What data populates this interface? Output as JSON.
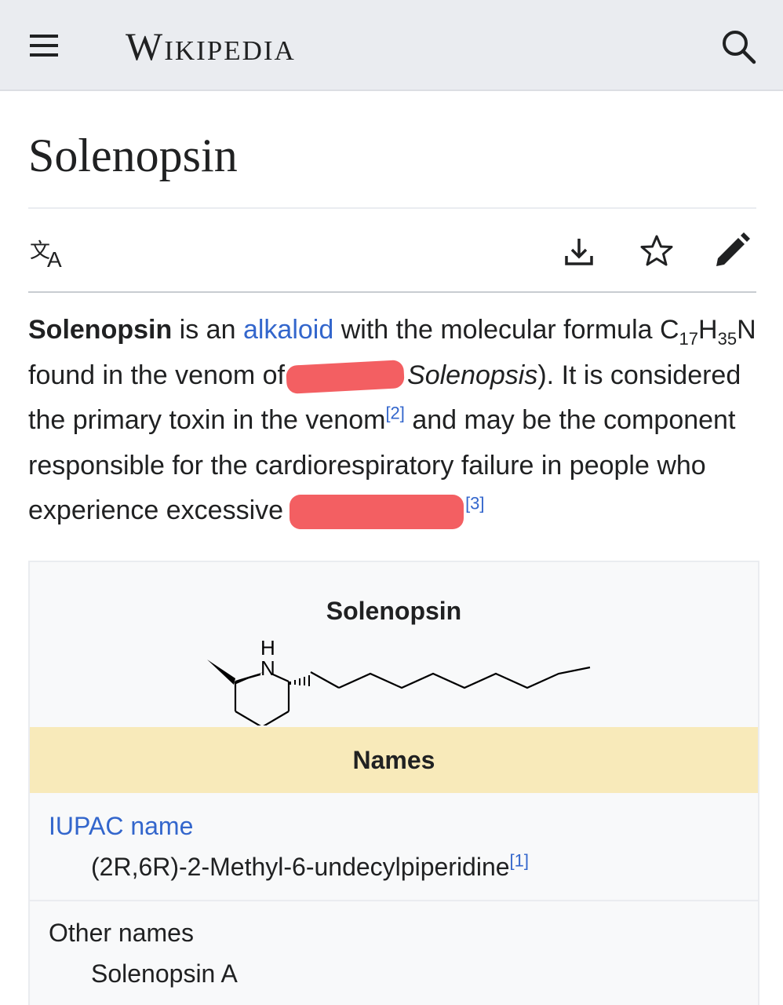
{
  "header": {
    "logo": "Wikipedia"
  },
  "article": {
    "title": "Solenopsin",
    "intro": {
      "bold_term": "Solenopsin",
      "t1": " is an ",
      "link_alkaloid": "alkaloid",
      "t2": " with the molecular formula C",
      "sub17": "17",
      "t3": "H",
      "sub35": "35",
      "t4": "N found in the venom of",
      "italic_genus": "Solenopsis",
      "t5": "). It is considered the primary toxin in the venom",
      "ref2": "[2]",
      "t6": " and may be the component responsible for the cardiorespiratory failure in people who experience excessive",
      "ref3": "[3]"
    }
  },
  "infobox": {
    "title": "Solenopsin",
    "names_header": "Names",
    "iupac_label": "IUPAC name",
    "iupac_value": "(2R,6R)-2-Methyl-6-undecylpiperidine",
    "iupac_ref": "[1]",
    "other_names_label": "Other names",
    "other_names_value": "Solenopsin A",
    "molecule_labels": {
      "h": "H",
      "n": "N"
    }
  },
  "icons": [
    "menu-icon",
    "search-icon",
    "language-icon",
    "download-icon",
    "star-icon",
    "edit-icon"
  ],
  "colors": {
    "link": "#3366cc",
    "header_bg": "#eaecf0",
    "names_bar": "#f8eaba",
    "redaction": "#f35f62"
  }
}
